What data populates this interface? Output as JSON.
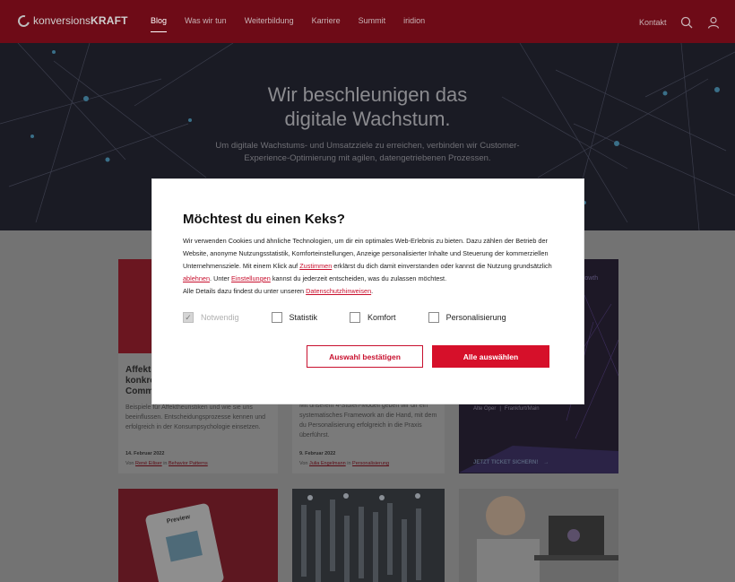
{
  "header": {
    "logo_light": "konversions",
    "logo_bold": "KRAFT",
    "nav": [
      "Blog",
      "Was wir tun",
      "Weiterbildung",
      "Karriere",
      "Summit",
      "iridion"
    ],
    "contact": "Kontakt"
  },
  "hero": {
    "title_line1": "Wir beschleunigen das",
    "title_line2": "digitale Wachstum.",
    "sub_line1": "Um digitale Wachstums- und Umsatzziele zu erreichen, verbinden wir Customer-",
    "sub_line2": "Experience-Optimierung mit agilen, datengetriebenen Prozessen."
  },
  "cards": {
    "c1": {
      "title": "Affekt\nkonkre\nComm",
      "text": "Beispiele für Affektheuristiken und wie sie uns beeinflussen. Entscheidungsprozesse kennen und erfolgreich in der Konsumpsychologie einsetzen.",
      "date": "14. Februar 2022",
      "meta_prefix": "Von",
      "author": "René Eiliser",
      "meta_in": "in",
      "category": "Behavior Patterns"
    },
    "c2": {
      "text": "Mit unserem 4-Stufen-Modell geben wir dir ein systematisches Framework an die Hand, mit dem du Personalisierung erfolgreich in die Praxis überführst.",
      "date": "9. Februar 2022",
      "meta_prefix": "Von",
      "author": "Julia Engelmann",
      "meta_in": "in",
      "category": "Personalisierung"
    },
    "c3": {
      "top_text": "rowth",
      "location_a": "Alte Oper",
      "location_sep": "|",
      "location_b": "Frankfurt/Main",
      "cta": "JETZT TICKET SICHERN!"
    },
    "c4": {
      "badge": "Preview"
    }
  },
  "modal": {
    "title": "Möchtest du einen Keks?",
    "p1": "Wir verwenden Cookies und ähnliche Technologien, um dir ein optimales Web-Erlebnis zu bieten. Dazu zählen der Betrieb der Website, anonyme Nutzungsstatistik, Komforteinstellungen, Anzeige personalisierter Inhalte und Steuerung der kommerziellen Unternehmensziele. Mit einem Klick auf ",
    "link_zustimmen": "Zustimmen",
    "p2": " erklärst du dich damit einverstanden oder kannst die Nutzung grundsätzlich ",
    "link_ablehnen": "ablehnen",
    "p3": ". Unter ",
    "link_einstellungen": "Einstellungen",
    "p4": " kannst du jederzeit entscheiden, was du zulassen möchtest.",
    "p5": "Alle Details dazu findest du unter unseren ",
    "link_datenschutz": "Datenschutzhinweisen",
    "p6": ".",
    "checkboxes": [
      {
        "label": "Notwendig",
        "checked": true,
        "disabled": true
      },
      {
        "label": "Statistik",
        "checked": false,
        "disabled": false
      },
      {
        "label": "Komfort",
        "checked": false,
        "disabled": false
      },
      {
        "label": "Personalisierung",
        "checked": false,
        "disabled": false
      }
    ],
    "btn_confirm": "Auswahl bestätigen",
    "btn_all": "Alle auswählen"
  }
}
